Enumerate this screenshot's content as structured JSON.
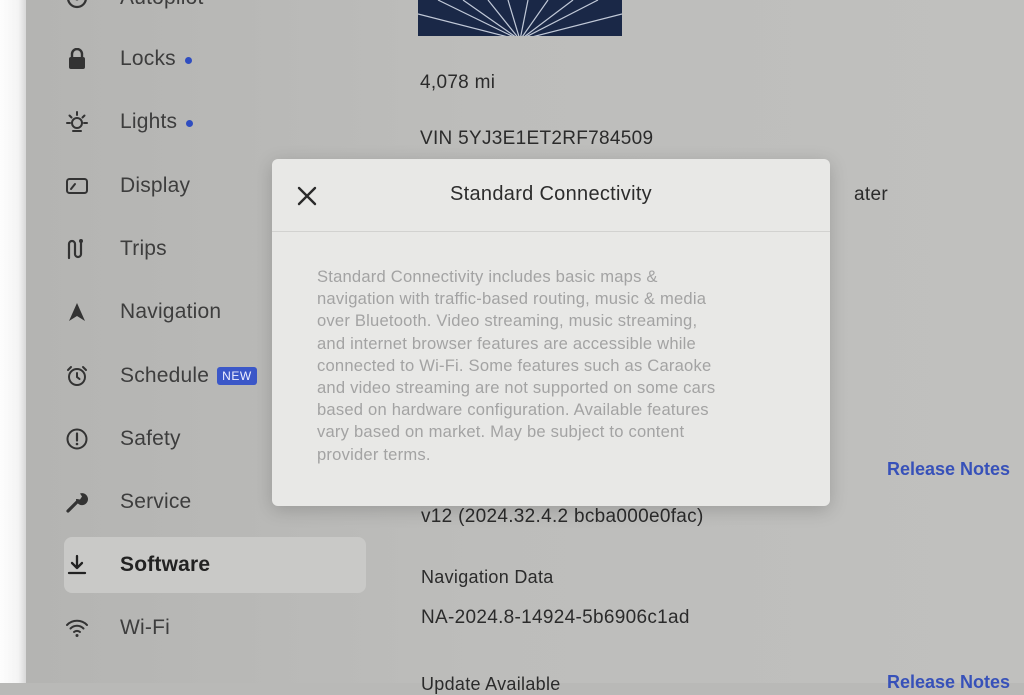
{
  "sidebar": {
    "items": [
      {
        "label": "Autopilot",
        "icon": "steering-wheel-icon"
      },
      {
        "label": "Locks",
        "icon": "lock-icon",
        "dot": true
      },
      {
        "label": "Lights",
        "icon": "light-icon",
        "dot": true
      },
      {
        "label": "Display",
        "icon": "display-icon"
      },
      {
        "label": "Trips",
        "icon": "trips-icon"
      },
      {
        "label": "Navigation",
        "icon": "navigation-icon"
      },
      {
        "label": "Schedule",
        "icon": "alarm-clock-icon",
        "badge": "NEW"
      },
      {
        "label": "Safety",
        "icon": "exclamation-icon"
      },
      {
        "label": "Service",
        "icon": "wrench-icon"
      },
      {
        "label": "Software",
        "icon": "download-icon",
        "active": true
      },
      {
        "label": "Wi-Fi",
        "icon": "wifi-icon"
      }
    ]
  },
  "content": {
    "odometer": "4,078 mi",
    "vin": "VIN 5YJ3E1ET2RF784509",
    "partial_text": "ater",
    "release_notes_label": "Release Notes",
    "software_version": "v12 (2024.32.4.2 bcba000e0fac)",
    "navigation_data_label": "Navigation Data",
    "navigation_data_value": "NA-2024.8-14924-5b6906c1ad",
    "update_available_partial": "Update Available",
    "release_notes_partial": "Release Notes"
  },
  "modal": {
    "title": "Standard Connectivity",
    "lines": [
      "Standard Connectivity includes basic maps &",
      "navigation with traffic-based routing, music & media",
      "over Bluetooth. Video streaming, music streaming,",
      "and internet browser features are accessible while",
      "connected to Wi-Fi. Some features such as Caraoke",
      "and video streaming are not supported on some cars",
      "based on hardware configuration. Available features",
      "vary based on market. May be subject to content",
      "provider terms."
    ]
  },
  "colors": {
    "accent": "#3751b9",
    "dot": "#2f4dc0",
    "badge": "#3b57c8",
    "modal_bg": "#e8e8e6",
    "screen_bg": "#bdbdbb"
  }
}
